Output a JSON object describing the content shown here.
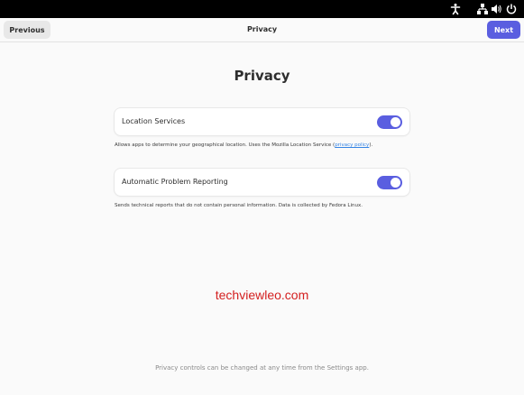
{
  "topbar": {
    "icons": [
      "accessibility-icon",
      "network-icon",
      "volume-icon",
      "power-icon"
    ]
  },
  "header": {
    "previous_label": "Previous",
    "title": "Privacy",
    "next_label": "Next"
  },
  "page": {
    "heading": "Privacy"
  },
  "location": {
    "label": "Location Services",
    "enabled": true,
    "desc_prefix": "Allows apps to determine your geographical location. Uses the Mozilla Location Service (",
    "link": "privacy policy",
    "desc_suffix": ")."
  },
  "reporting": {
    "label": "Automatic Problem Reporting",
    "enabled": true,
    "desc": "Sends technical reports that do not contain personal information. Data is collected by Fedora Linux."
  },
  "watermark": "techviewleo.com",
  "footer": "Privacy controls can be changed at any time from the Settings app.",
  "colors": {
    "accent": "#5a5ee0",
    "topbar": "#000000",
    "background": "#fafafa",
    "watermark": "#d42020"
  }
}
